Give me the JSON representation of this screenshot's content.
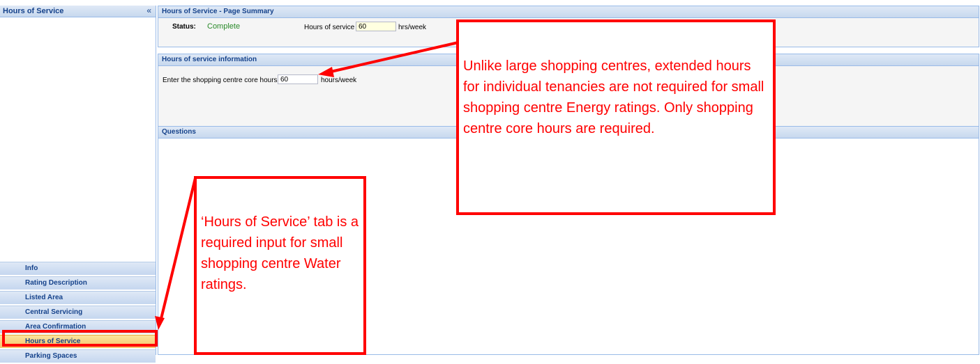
{
  "sidebar": {
    "title": "Hours of Service",
    "collapse_glyph": "«",
    "nav": [
      {
        "label": "Info"
      },
      {
        "label": "Rating Description"
      },
      {
        "label": "Listed Area"
      },
      {
        "label": "Central Servicing"
      },
      {
        "label": "Area Confirmation"
      },
      {
        "label": "Hours of Service",
        "active": true
      },
      {
        "label": "Parking Spaces"
      }
    ]
  },
  "summary": {
    "title": "Hours of Service - Page Summary",
    "status_label": "Status:",
    "status_value": "Complete",
    "hours_label": "Hours of service",
    "hours_value": "60",
    "hours_unit": "hrs/week"
  },
  "info": {
    "title": "Hours of service information",
    "core_label": "Enter the shopping centre core hours",
    "core_value": "60",
    "core_unit": "hours/week"
  },
  "questions": {
    "title": "Questions"
  },
  "callouts": {
    "energy": "Unlike large shopping centres, extended hours for individual tenancies are not required for small shopping centre Energy ratings. Only shopping centre core hours are required.",
    "water": "‘Hours of Service’ tab is a required input for small shopping centre Water ratings."
  },
  "colors": {
    "accent": "#15428b",
    "annotation": "#ff0000",
    "status_ok": "#2a8a2a"
  }
}
